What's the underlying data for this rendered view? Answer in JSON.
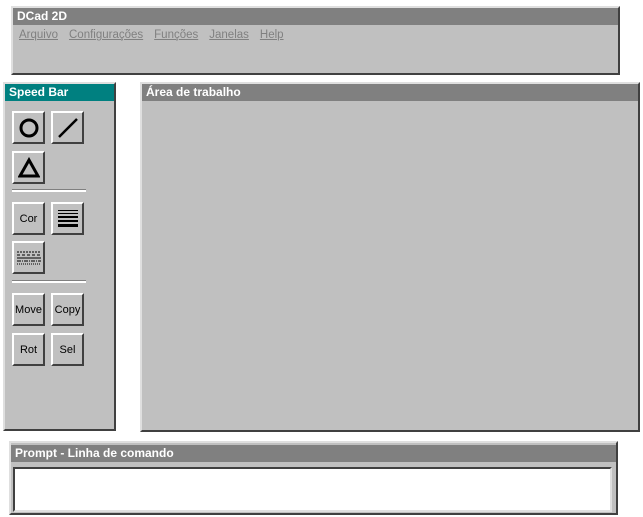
{
  "app": {
    "title": "DCad 2D"
  },
  "menu": {
    "items": [
      "Arquivo",
      "Configurações",
      "Funções",
      "Janelas",
      "Help"
    ]
  },
  "speedbar": {
    "title": "Speed Bar",
    "tools": {
      "circle_icon": "circle-icon",
      "line_icon": "line-icon",
      "triangle_icon": "triangle-icon",
      "cor": "Cor",
      "line_width_icon": "line-width-icon",
      "line_style_icon": "line-style-icon",
      "move": "Move",
      "copy": "Copy",
      "rot": "Rot",
      "sel": "Sel"
    }
  },
  "workarea": {
    "title": "Área de trabalho"
  },
  "prompt": {
    "title": "Prompt - Linha de comando",
    "value": ""
  },
  "colors": {
    "face": "#c0c0c0",
    "active_title": "#008080",
    "inactive_title": "#808080"
  }
}
